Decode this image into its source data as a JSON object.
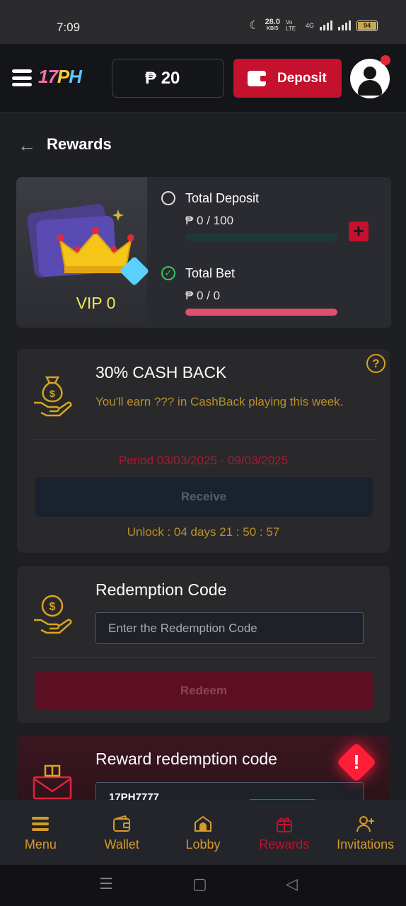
{
  "status_bar": {
    "time": "7:09",
    "speed_value": "28.0",
    "speed_unit": "KB/S",
    "network": "Vo LTE",
    "network_gen": "4G",
    "battery": "94"
  },
  "header": {
    "logo": [
      "17",
      "P",
      "H"
    ],
    "currency_symbol": "₱",
    "balance": "20",
    "deposit_label": "Deposit"
  },
  "page": {
    "title": "Rewards"
  },
  "vip": {
    "level_label": "VIP 0",
    "total_deposit_label": "Total Deposit",
    "total_deposit_value": "₱ 0 / 100",
    "total_deposit_progress": 0,
    "total_bet_label": "Total Bet",
    "total_bet_value": "₱ 0 / 0",
    "total_bet_progress": 1
  },
  "cashback": {
    "title": "30% CASH BACK",
    "description": "You'll earn ??? in CashBack playing this week.",
    "period": "Period 03/03/2025 - 09/03/2025",
    "receive_label": "Receive",
    "unlock_text": "Unlock : 04 days 21 : 50 : 57"
  },
  "redemption": {
    "title": "Redemption Code",
    "input_placeholder": "Enter the Redemption Code",
    "redeem_label": "Redeem"
  },
  "reward_redemption": {
    "title": "Reward redemption code",
    "code": "17PH7777"
  },
  "bottom_nav": {
    "items": [
      {
        "label": "Menu",
        "icon": "menu-icon"
      },
      {
        "label": "Wallet",
        "icon": "wallet-icon"
      },
      {
        "label": "Lobby",
        "icon": "home-icon"
      },
      {
        "label": "Rewards",
        "icon": "gift-icon",
        "active": true
      },
      {
        "label": "Invitations",
        "icon": "add-user-icon"
      }
    ]
  },
  "colors": {
    "accent_red": "#c3112e",
    "gold": "#d59a28",
    "vip_yellow": "#f3e65a",
    "progress_green": "#38c45a"
  }
}
